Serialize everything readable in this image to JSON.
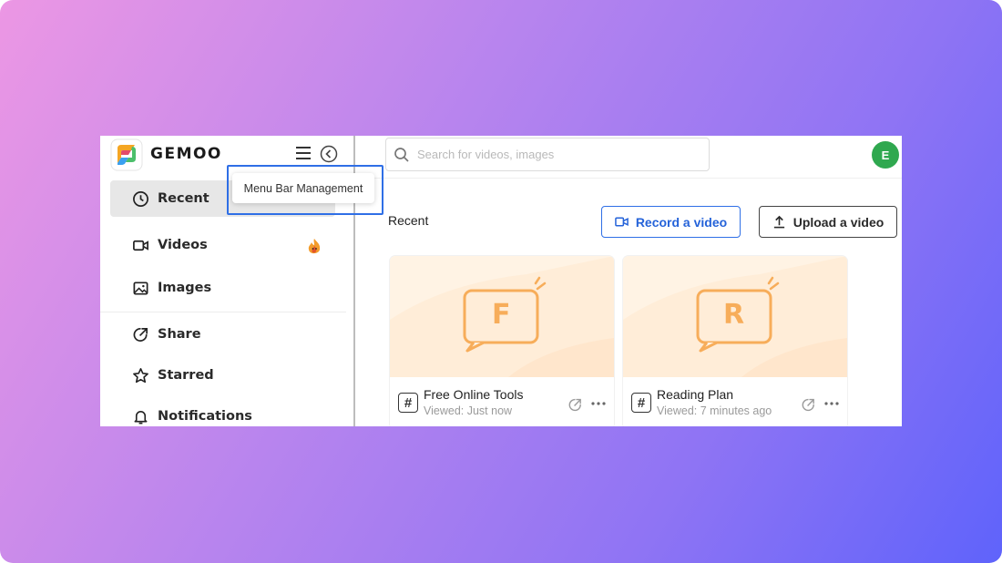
{
  "brand": {
    "name": "GEMOO"
  },
  "tooltip": {
    "text": "Menu Bar Management"
  },
  "sidebar": {
    "items": [
      {
        "label": "Recent",
        "icon": "clock-icon"
      },
      {
        "label": "Videos",
        "icon": "video-icon"
      },
      {
        "label": "Images",
        "icon": "image-icon"
      },
      {
        "label": "Share",
        "icon": "share-icon"
      },
      {
        "label": "Starred",
        "icon": "star-icon"
      },
      {
        "label": "Notifications",
        "icon": "bell-icon"
      }
    ]
  },
  "search": {
    "placeholder": "Search for videos, images"
  },
  "user": {
    "initial": "E",
    "avatar_color": "#2fa84f"
  },
  "main": {
    "section_title": "Recent",
    "record_label": "Record a video",
    "upload_label": "Upload a video"
  },
  "cards": [
    {
      "letter": "F",
      "name": "Free Online Tools",
      "meta": "Viewed: Just now"
    },
    {
      "letter": "R",
      "name": "Reading Plan",
      "meta": "Viewed: 7 minutes ago"
    }
  ],
  "colors": {
    "accent": "#2f6fe6",
    "thumb_bg": "#fff3e4",
    "thumb_icon": "#f7ad5a"
  }
}
